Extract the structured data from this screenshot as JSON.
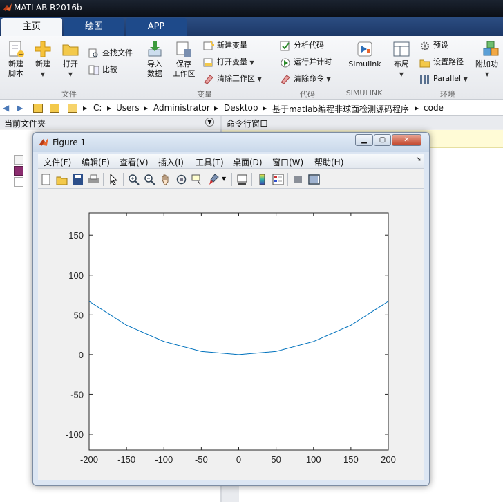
{
  "app": {
    "title": "MATLAB R2016b"
  },
  "tabs": [
    {
      "label": "主页"
    },
    {
      "label": "绘图"
    },
    {
      "label": "APP"
    }
  ],
  "ribbon": {
    "file": {
      "new_script": "新建\n脚本",
      "new": "新建",
      "open": "打开",
      "find_files": "查找文件",
      "compare": "比较",
      "section": "文件"
    },
    "variable": {
      "import": "导入\n数据",
      "save_workspace": "保存\n工作区",
      "new_variable": "新建变量",
      "open_variable": "打开变量",
      "clear_workspace": "清除工作区",
      "section": "变量"
    },
    "code": {
      "analyze": "分析代码",
      "run_time": "运行并计时",
      "clear_commands": "清除命令",
      "section": "代码"
    },
    "simulink": {
      "label": "Simulink",
      "section": "SIMULINK"
    },
    "environment": {
      "layout": "布局",
      "preferences": "预设",
      "set_path": "设置路径",
      "parallel": "Parallel",
      "addons": "附加功",
      "section": "环境"
    }
  },
  "address": {
    "segments": [
      "C:",
      "Users",
      "Administrator",
      "Desktop",
      "基于matlab编程非球面检测源码程序",
      "code"
    ]
  },
  "panels": {
    "current_folder": "当前文件夹",
    "command_window": "命令行窗口"
  },
  "figure": {
    "title": "Figure 1",
    "menu": [
      "文件(F)",
      "编辑(E)",
      "查看(V)",
      "插入(I)",
      "工具(T)",
      "桌面(D)",
      "窗口(W)",
      "帮助(H)"
    ],
    "toolbar_icons": [
      "new-figure-icon",
      "open-file-icon",
      "save-icon",
      "print-icon",
      "pointer-icon",
      "zoom-in-icon",
      "zoom-out-icon",
      "pan-hand-icon",
      "rotate-3d-icon",
      "data-cursor-icon",
      "brush-icon",
      "link-plot-icon",
      "colorbar-icon",
      "legend-icon",
      "hide-plot-tools-icon",
      "show-plot-tools-icon"
    ]
  },
  "chart_data": {
    "type": "line",
    "title": "",
    "xlabel": "",
    "ylabel": "",
    "xlim": [
      -200,
      200
    ],
    "ylim": [
      -120,
      178
    ],
    "xticks": [
      -200,
      -150,
      -100,
      -50,
      0,
      50,
      100,
      150,
      200
    ],
    "yticks": [
      -100,
      -50,
      0,
      50,
      100,
      150
    ],
    "series": [
      {
        "color": "#0072bd",
        "x": [
          -200,
          -150,
          -100,
          -50,
          0,
          50,
          100,
          150,
          200
        ],
        "y": [
          67,
          37,
          16.5,
          4,
          0,
          4,
          16.5,
          37,
          67
        ]
      }
    ],
    "grid": false
  }
}
